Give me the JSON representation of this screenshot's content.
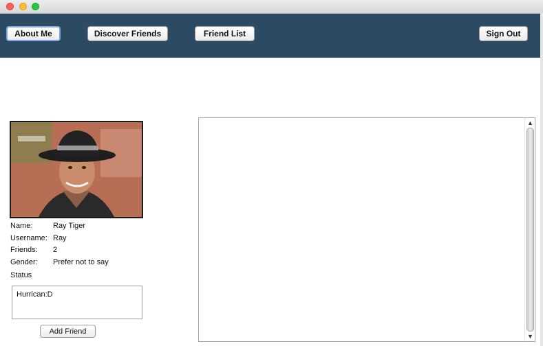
{
  "window": {
    "controls": [
      "close-icon",
      "minimize-icon",
      "zoom-icon"
    ]
  },
  "nav": {
    "about_me": "About Me",
    "discover_friends": "Discover Friends",
    "friend_list": "Friend List",
    "sign_out": "Sign Out",
    "active": "about_me",
    "bar_color": "#2d4a63"
  },
  "profile": {
    "photo_icon": "user-photo",
    "rows": [
      {
        "label": "Name:",
        "value": "Ray Tiger"
      },
      {
        "label": "Username:",
        "value": "Ray"
      },
      {
        "label": "Friends:",
        "value": "2"
      },
      {
        "label": "Gender:",
        "value": "Prefer not to say"
      }
    ],
    "status_label": "Status",
    "status_text": "Hurrican:D",
    "add_friend": "Add Friend"
  },
  "content_pane": {
    "text": ""
  }
}
